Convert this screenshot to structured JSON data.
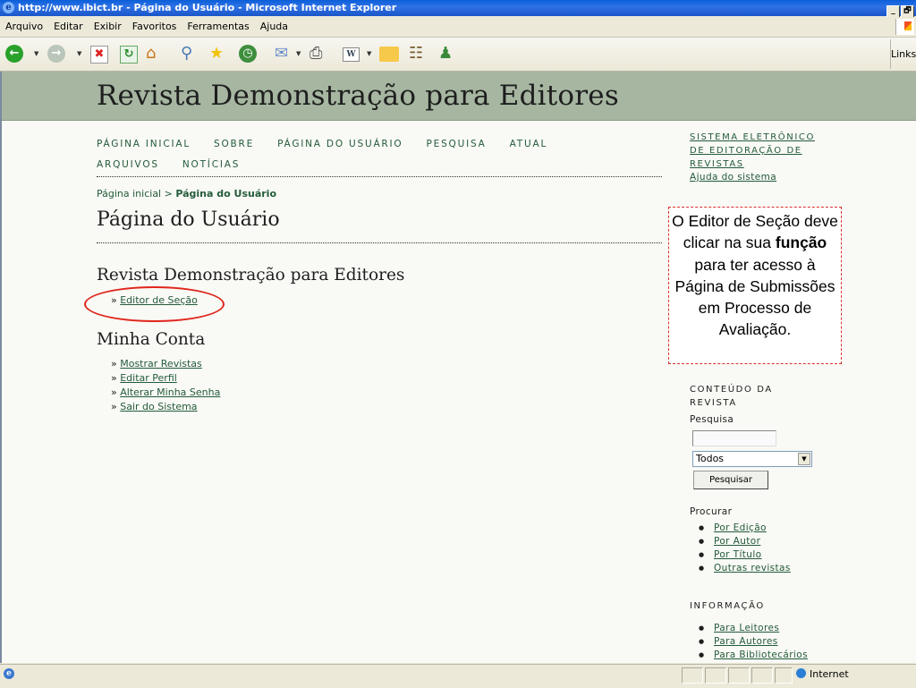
{
  "window": {
    "title": "http://www.ibict.br - Página do Usuário - Microsoft Internet Explorer",
    "controls": [
      "_",
      "🗗"
    ]
  },
  "menu": [
    "Arquivo",
    "Editar",
    "Exibir",
    "Favoritos",
    "Ferramentas",
    "Ajuda"
  ],
  "toolbar": {
    "links_label": "Links",
    "icons": [
      "back-icon",
      "forward-icon",
      "stop-icon",
      "refresh-icon",
      "home-icon",
      "search-icon",
      "favorites-icon",
      "history-icon",
      "mail-icon",
      "print-icon",
      "edit-icon",
      "folder-icon",
      "research-icon",
      "messenger-icon"
    ]
  },
  "journal": {
    "title": "Revista Demonstração para Editores"
  },
  "nav": {
    "items": [
      "PÁGINA INICIAL",
      "SOBRE",
      "PÁGINA DO USUÁRIO",
      "PESQUISA",
      "ATUAL",
      "ARQUIVOS",
      "NOTÍCIAS"
    ]
  },
  "breadcrumb": {
    "home": "Página inicial",
    "separator": ">",
    "current": "Página do Usuário"
  },
  "main": {
    "page_title": "Página do Usuário",
    "journal_section": "Revista Demonstração para Editores",
    "role_link": "Editor de Seção",
    "account_title": "Minha Conta",
    "account_links": [
      "Mostrar Revistas",
      "Editar Perfil",
      "Alterar Minha Senha",
      "Sair do Sistema"
    ]
  },
  "callout": {
    "text_before": "O Editor de Seção deve clicar na sua",
    "bold": "função",
    "text_after": "para ter acesso à Página de Submissões em Processo de Avaliação."
  },
  "sidebar": {
    "system_link": "SISTEMA ELETRÔNICO DE EDITORAÇÃO DE REVISTAS",
    "help_link": "Ajuda do sistema",
    "content_title": "CONTEÚDO DA REVISTA",
    "search_label": "Pesquisa",
    "search_value": "",
    "select_value": "Todos",
    "search_button": "Pesquisar",
    "browse_label": "Procurar",
    "browse_links": [
      "Por Edição",
      "Por Autor",
      "Por Título",
      "Outras revistas"
    ],
    "info_title": "INFORMAÇÃO",
    "info_links": [
      "Para Leitores",
      "Para Autores",
      "Para Bibliotecários"
    ]
  },
  "status": {
    "zone": "Internet"
  },
  "colors": {
    "header_bg": "#a6b6a1",
    "link_green": "#235b3a",
    "annotation_red": "#e0251b"
  }
}
